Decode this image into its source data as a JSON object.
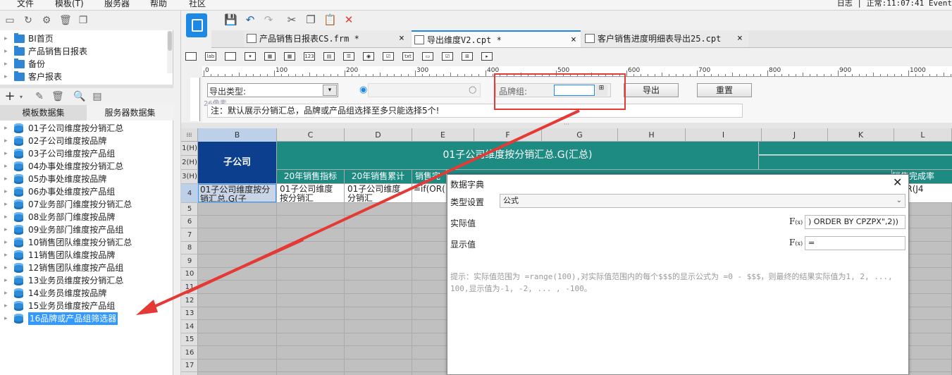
{
  "menu": [
    "文件",
    "模板(T)",
    "服务器",
    "帮助",
    "社区"
  ],
  "status": "日志 | 正常:11:07:41 Event",
  "top_tree": [
    {
      "label": "BI首页"
    },
    {
      "label": "产品销售日报表"
    },
    {
      "label": "备份"
    },
    {
      "label": "客户报表"
    }
  ],
  "left_tabs": [
    "模板数据集",
    "服务器数据集"
  ],
  "datasets": [
    "01子公司维度按分销汇总",
    "02子公司维度按品牌",
    "03子公司维度按产品组",
    "04办事处维度按分销汇总",
    "05办事处维度按品牌",
    "06办事处维度按产品组",
    "07业务部门维度按分销汇总",
    "08业务部门维度按品牌",
    "09业务部门维度按产品组",
    "10销售团队维度按分销汇总",
    "11销售团队维度按品牌",
    "12销售团队维度按产品组",
    "13业务员维度按分销汇总",
    "14业务员维度按品牌",
    "15业务员维度按产品组",
    "16品牌或产品组筛选器"
  ],
  "doc_tabs": [
    "产品销售日报表CS.frm *",
    "导出维度V2.cpt *",
    "客户销售进度明细表导出25.cpt"
  ],
  "ruler": [
    "0",
    "100",
    "200",
    "300",
    "400",
    "500",
    "600",
    "700",
    "800",
    "900",
    "1000"
  ],
  "param": {
    "export_type_label": "导出类型:",
    "pixel_label": "26像素",
    "brand_group_label": "品牌组:",
    "export_button": "导出",
    "reset_button": "重置",
    "note": "注：默认展示分销汇总，品牌或产品组选择至多只能选择5个!"
  },
  "columns": [
    "B",
    "C",
    "D",
    "E",
    "F",
    "G",
    "H",
    "I",
    "J",
    "K",
    "L"
  ],
  "rows": [
    "1(H)",
    "2(H)",
    "3(H)",
    "4",
    "5",
    "6",
    "7",
    "8",
    "9",
    "10",
    "11",
    "12",
    "13",
    "14",
    "15",
    "16",
    "17"
  ],
  "cells": {
    "b_header": "子公司",
    "title": "01子公司维度按分销汇总.G(汇总)",
    "c3": "20年销售指标",
    "d3": "20年销售累计",
    "e3": "销售完",
    "l3": "销售完成率",
    "b4": "01子公司维度按分销汇总.G(子",
    "c4": "01子公司维度按分销汇",
    "d4": "01子公司维度分销汇",
    "e4": "=if(OR(",
    "l4": "f(OR(J4"
  },
  "dialog": {
    "title": "数据字典",
    "type_label": "类型设置",
    "type_value": "公式",
    "actual_label": "实际值",
    "actual_value": ") ORDER BY CPZPX\",2))",
    "display_label": "显示值",
    "display_value": "=",
    "hint": "提示：实际值范围为 =range(100),对实际值范围内的每个$$$的显示公式为 =0 - $$$，则最终的结果实际值为1, 2, ..., 100,显示值为-1, -2, ... , -100。"
  },
  "colors": {
    "accent": "#1e8b83",
    "selection": "#3399ff",
    "arrow": "#e53935",
    "header": "#0d3f8f"
  }
}
